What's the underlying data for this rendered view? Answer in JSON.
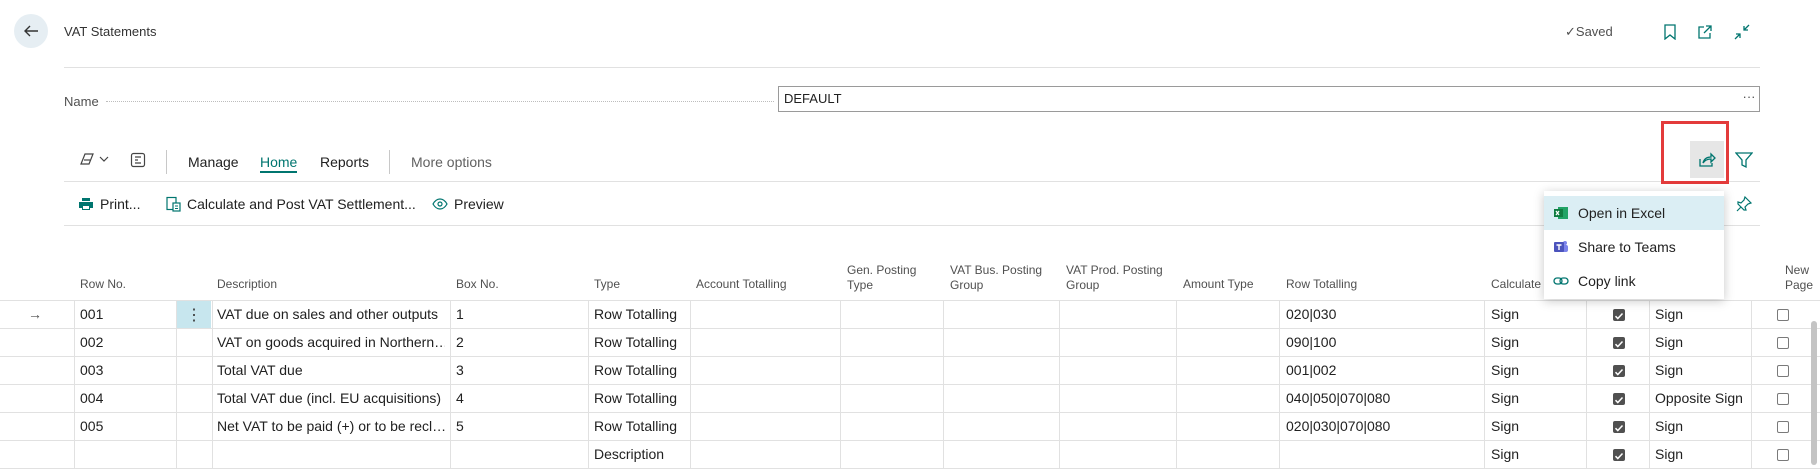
{
  "header": {
    "title": "VAT Statements",
    "saved_label": "Saved"
  },
  "name_field": {
    "label": "Name",
    "value": "DEFAULT",
    "more": "···"
  },
  "tabs": [
    "Manage",
    "Home",
    "Reports",
    "More options"
  ],
  "actions": [
    "Print...",
    "Calculate and Post VAT Settlement...",
    "Preview"
  ],
  "share_menu": {
    "items": [
      "Open in Excel",
      "Share to Teams",
      "Copy link"
    ]
  },
  "columns": {
    "row_no": "Row No.",
    "description": "Description",
    "box_no": "Box No.",
    "type": "Type",
    "account_totalling": "Account Totalling",
    "gen_posting_type": [
      "Gen. Posting",
      "Type"
    ],
    "vat_bus_posting_group": [
      "VAT Bus. Posting",
      "Group"
    ],
    "vat_prod_posting_group": [
      "VAT Prod. Posting",
      "Group"
    ],
    "amount_type": "Amount Type",
    "row_totalling": "Row Totalling",
    "calculate_with": "Calculate w",
    "new_page": [
      "New",
      "Page"
    ]
  },
  "rows": [
    {
      "row_no": "001",
      "description": "VAT due on sales and other outputs",
      "box_no": "1",
      "type": "Row Totalling",
      "row_totalling": "020|030",
      "calculate_with": "Sign",
      "print": true,
      "print_with": "Sign",
      "new_page": false
    },
    {
      "row_no": "002",
      "description": "VAT on goods acquired in Northern…",
      "box_no": "2",
      "type": "Row Totalling",
      "row_totalling": "090|100",
      "calculate_with": "Sign",
      "print": true,
      "print_with": "Sign",
      "new_page": false
    },
    {
      "row_no": "003",
      "description": "Total VAT due",
      "box_no": "3",
      "type": "Row Totalling",
      "row_totalling": "001|002",
      "calculate_with": "Sign",
      "print": true,
      "print_with": "Sign",
      "new_page": false
    },
    {
      "row_no": "004",
      "description": "Total VAT due (incl. EU acquisitions)",
      "box_no": "4",
      "type": "Row Totalling",
      "row_totalling": "040|050|070|080",
      "calculate_with": "Sign",
      "print": true,
      "print_with": "Opposite Sign",
      "new_page": false
    },
    {
      "row_no": "005",
      "description": "Net VAT to be paid (+) or to be recl…",
      "box_no": "5",
      "type": "Row Totalling",
      "row_totalling": "020|030|070|080",
      "calculate_with": "Sign",
      "print": true,
      "print_with": "Sign",
      "new_page": false
    },
    {
      "row_no": "",
      "description": "",
      "box_no": "",
      "type": "Description",
      "row_totalling": "",
      "calculate_with": "Sign",
      "print": true,
      "print_with": "Sign",
      "new_page": false
    }
  ],
  "colors": {
    "accent": "#00756f",
    "highlight_border": "#e33b3b",
    "menu_selected": "#dbeef4",
    "back_button_bg": "#e6eef3"
  }
}
